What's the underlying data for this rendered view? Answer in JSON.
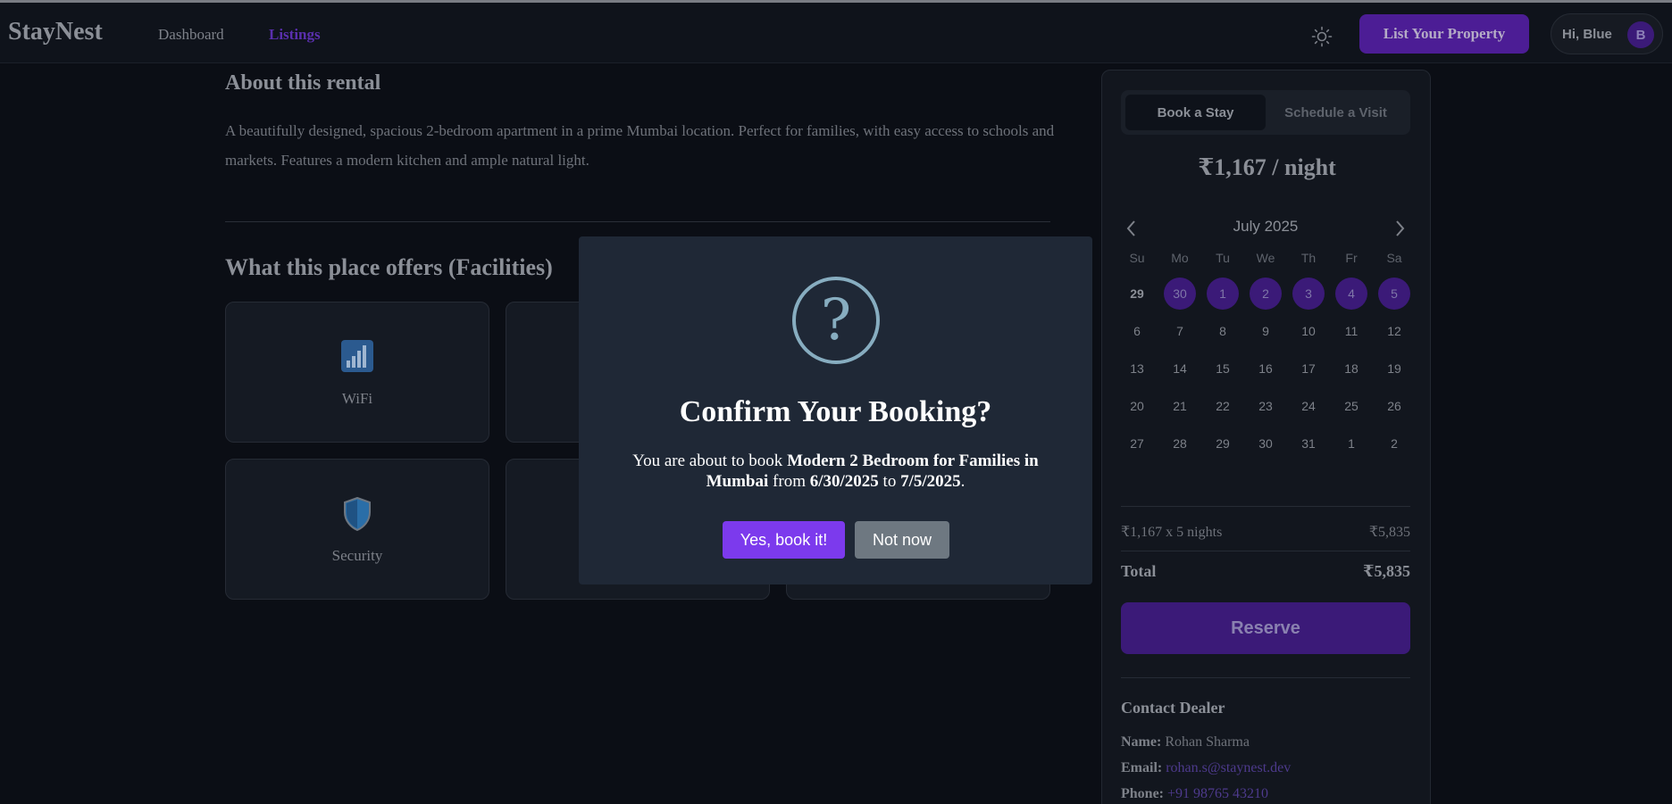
{
  "nav": {
    "brand": "StayNest",
    "links": [
      "Dashboard",
      "Listings"
    ],
    "list_property": "List Your Property",
    "greeting": "Hi, Blue",
    "avatar_initial": "B"
  },
  "about": {
    "title": "About this rental",
    "text": "A beautifully designed, spacious 2-bedroom apartment in a prime Mumbai location. Perfect for families, with easy access to schools and markets. Features a modern kitchen and ample natural light."
  },
  "facilities": {
    "title": "What this place offers (Facilities)",
    "items": [
      {
        "label": "WiFi",
        "icon": "wifi-signal-icon"
      },
      {
        "label": "",
        "icon": ""
      },
      {
        "label": "Security",
        "icon": "shield-icon"
      },
      {
        "label": "",
        "icon": ""
      },
      {
        "label": "",
        "icon": ""
      }
    ]
  },
  "booking": {
    "tabs": [
      "Book a Stay",
      "Schedule a Visit"
    ],
    "price": "₹1,167 / night",
    "calendar": {
      "month": "July 2025",
      "weekdays": [
        "Su",
        "Mo",
        "Tu",
        "We",
        "Th",
        "Fr",
        "Sa"
      ],
      "weeks": [
        [
          "29",
          "30",
          "1",
          "2",
          "3",
          "4",
          "5"
        ],
        [
          "6",
          "7",
          "8",
          "9",
          "10",
          "11",
          "12"
        ],
        [
          "13",
          "14",
          "15",
          "16",
          "17",
          "18",
          "19"
        ],
        [
          "20",
          "21",
          "22",
          "23",
          "24",
          "25",
          "26"
        ],
        [
          "27",
          "28",
          "29",
          "30",
          "31",
          "1",
          "2"
        ]
      ]
    },
    "calc_label": "₹1,167 x 5 nights",
    "calc_value": "₹5,835",
    "total_label": "Total",
    "total_value": "₹5,835",
    "reserve": "Reserve"
  },
  "contact": {
    "title": "Contact Dealer",
    "name_label": "Name:",
    "name": "Rohan Sharma",
    "email_label": "Email:",
    "email": "rohan.s@staynest.dev",
    "phone_label": "Phone:",
    "phone": "+91 98765 43210"
  },
  "modal": {
    "icon_glyph": "?",
    "title": "Confirm Your Booking?",
    "text_prefix": "You are about to book ",
    "listing": "Modern 2 Bedroom for Families in Mumbai",
    "text_from": " from ",
    "start_date": "6/30/2025",
    "text_to": " to ",
    "end_date": "7/5/2025",
    "text_end": ".",
    "confirm": "Yes, book it!",
    "cancel": "Not now"
  },
  "colors": {
    "accent": "#7c3aed",
    "accent_dim": "#4c1d95",
    "modal_bg": "#1f2836",
    "question_icon": "#87adc0"
  }
}
